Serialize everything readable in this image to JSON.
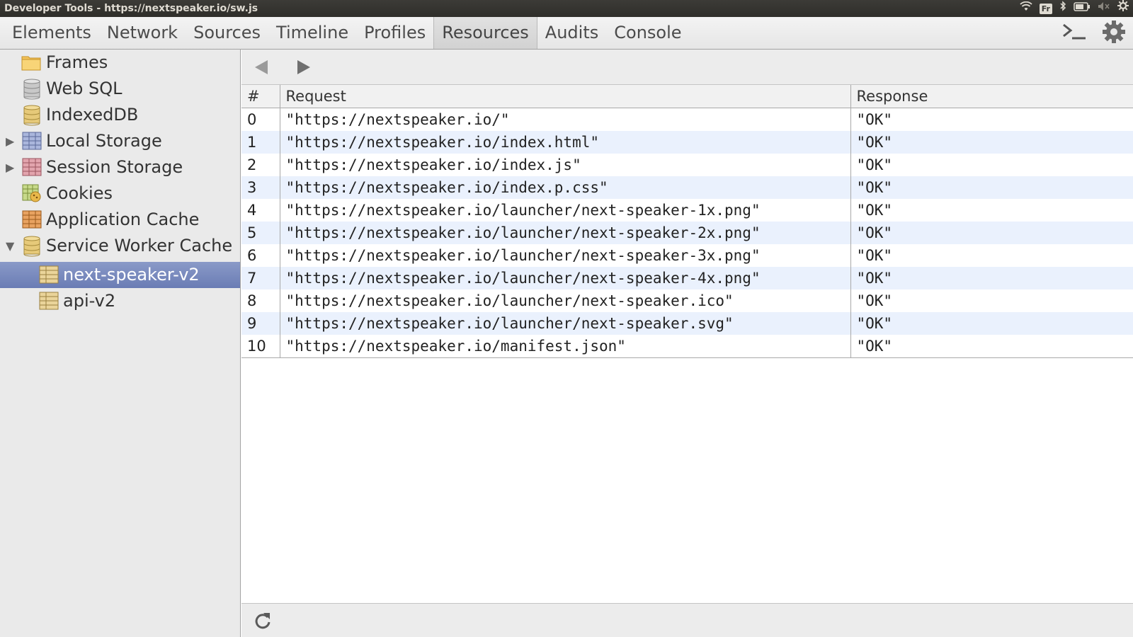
{
  "window": {
    "title": "Developer Tools - https://nextspeaker.io/sw.js",
    "keyboard_indicator": "Fr"
  },
  "toolbar": {
    "tabs": [
      "Elements",
      "Network",
      "Sources",
      "Timeline",
      "Profiles",
      "Resources",
      "Audits",
      "Console"
    ],
    "active_tab": "Resources"
  },
  "sidebar": {
    "items": [
      {
        "label": "Frames",
        "icon": "folder-icon"
      },
      {
        "label": "Web SQL",
        "icon": "database-icon"
      },
      {
        "label": "IndexedDB",
        "icon": "database-icon"
      },
      {
        "label": "Local Storage",
        "icon": "table-icon"
      },
      {
        "label": "Session Storage",
        "icon": "table-icon"
      },
      {
        "label": "Cookies",
        "icon": "cookie-icon"
      },
      {
        "label": "Application Cache",
        "icon": "table-icon"
      },
      {
        "label": "Service Worker Cache",
        "icon": "database-icon"
      },
      {
        "label": "next-speaker-v2",
        "icon": "table-icon",
        "selected": true
      },
      {
        "label": "api-v2",
        "icon": "table-icon"
      }
    ]
  },
  "table": {
    "headers": {
      "index": "#",
      "request": "Request",
      "response": "Response"
    },
    "rows": [
      {
        "index": "0",
        "request": "\"https://nextspeaker.io/\"",
        "response": "\"OK\""
      },
      {
        "index": "1",
        "request": "\"https://nextspeaker.io/index.html\"",
        "response": "\"OK\""
      },
      {
        "index": "2",
        "request": "\"https://nextspeaker.io/index.js\"",
        "response": "\"OK\""
      },
      {
        "index": "3",
        "request": "\"https://nextspeaker.io/index.p.css\"",
        "response": "\"OK\""
      },
      {
        "index": "4",
        "request": "\"https://nextspeaker.io/launcher/next-speaker-1x.png\"",
        "response": "\"OK\""
      },
      {
        "index": "5",
        "request": "\"https://nextspeaker.io/launcher/next-speaker-2x.png\"",
        "response": "\"OK\""
      },
      {
        "index": "6",
        "request": "\"https://nextspeaker.io/launcher/next-speaker-3x.png\"",
        "response": "\"OK\""
      },
      {
        "index": "7",
        "request": "\"https://nextspeaker.io/launcher/next-speaker-4x.png\"",
        "response": "\"OK\""
      },
      {
        "index": "8",
        "request": "\"https://nextspeaker.io/launcher/next-speaker.ico\"",
        "response": "\"OK\""
      },
      {
        "index": "9",
        "request": "\"https://nextspeaker.io/launcher/next-speaker.svg\"",
        "response": "\"OK\""
      },
      {
        "index": "10",
        "request": "\"https://nextspeaker.io/manifest.json\"",
        "response": "\"OK\""
      }
    ]
  },
  "colors": {
    "selection": "#7486bd",
    "row_stripe": "#eaf1fd",
    "titlebar": "#3c3b37"
  }
}
